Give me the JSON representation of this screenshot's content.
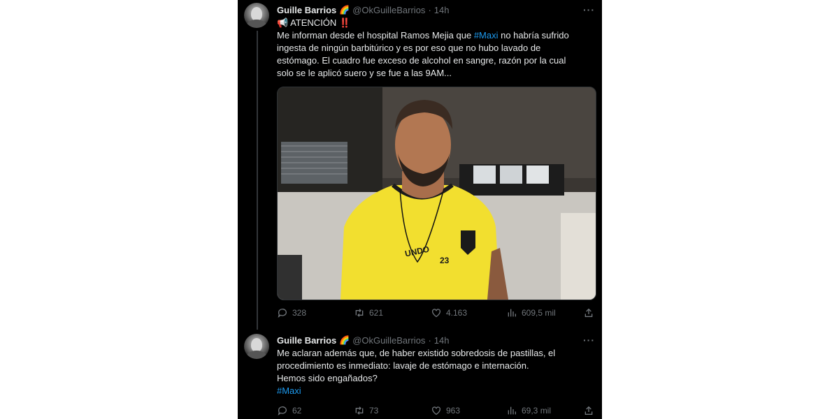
{
  "tweets": [
    {
      "author_name": "Guille Barrios",
      "author_emoji": "🌈",
      "handle": "@OkGuilleBarrios",
      "separator": "·",
      "time": "14h",
      "more": "···",
      "alert_emoji": "📢",
      "alert_label": "ATENCIÓN",
      "alert_marks": "‼️",
      "body_before_tag": "Me informan desde el  hospital Ramos Mejia que ",
      "hashtag": "#Maxi",
      "body_after_tag": " no habría sufrido ingesta de ningún barbitúrico y es por eso que no hubo lavado de estómago. El cuadro fue exceso de alcohol en sangre, razón por la cual solo se le aplicó suero y se fue a las 9AM...",
      "actions": {
        "replies": "328",
        "reposts": "621",
        "likes": "4.163",
        "views": "609,5 mil"
      }
    },
    {
      "author_name": "Guille Barrios",
      "author_emoji": "🌈",
      "handle": "@OkGuilleBarrios",
      "separator": "·",
      "time": "14h",
      "more": "···",
      "line1": "Me aclaran además que, de haber existido sobredosis de pastillas, el procedimiento es inmediato: lavaje de estómago e internación.",
      "line2": "Hemos sido engañados?",
      "hashtag": "#Maxi",
      "actions": {
        "replies": "62",
        "reposts": "73",
        "likes": "963",
        "views": "69,3 mil"
      }
    }
  ],
  "media": {
    "shirt_text": "UNDO",
    "shirt_number": "23"
  },
  "colors": {
    "background": "#000000",
    "text": "#e7e9ea",
    "secondary": "#71767b",
    "link": "#1d9bf0",
    "shirt": "#f5e63a"
  },
  "icons": [
    "reply-icon",
    "repost-icon",
    "like-icon",
    "views-icon",
    "share-icon",
    "more-icon",
    "megaphone-icon"
  ]
}
